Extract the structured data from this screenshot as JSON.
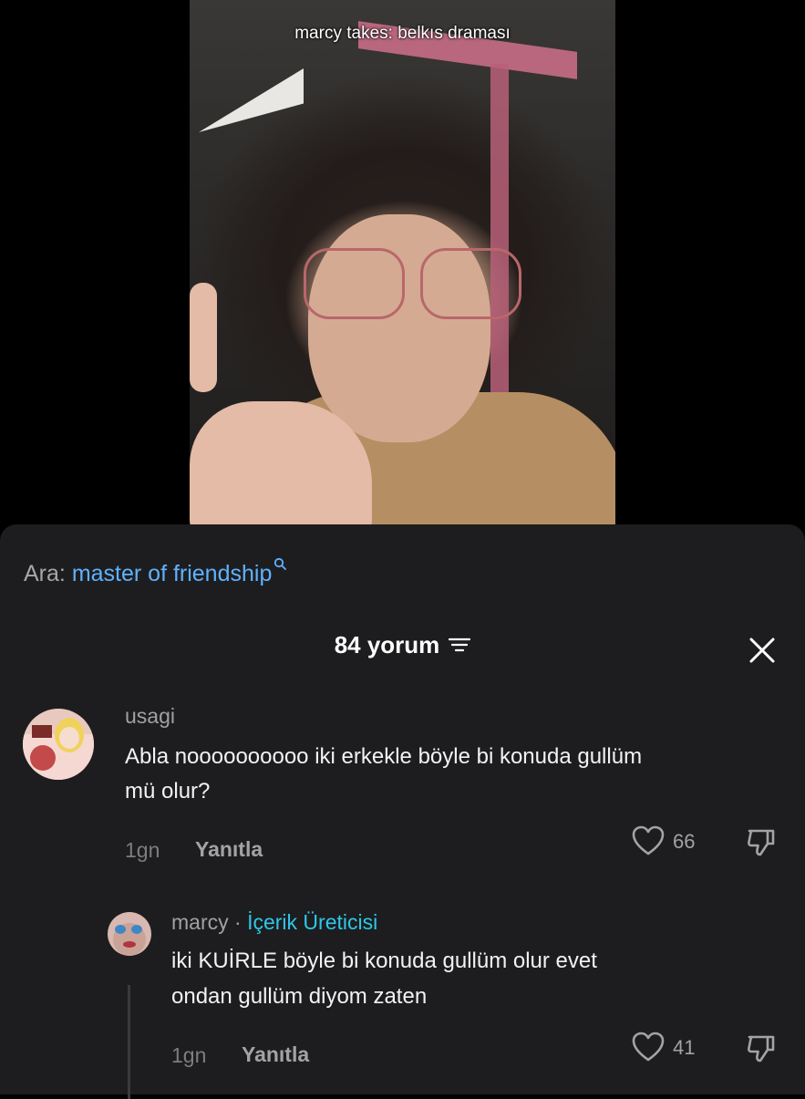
{
  "video": {
    "caption": "marcy takes: belkıs draması"
  },
  "search": {
    "prefix": "Ara:",
    "query": "master of friendship",
    "icon": "search-icon"
  },
  "comments_header": {
    "title": "84 yorum",
    "filter_icon": "filter-icon",
    "close_icon": "close-icon"
  },
  "comments": [
    {
      "username": "usagi",
      "text_line1": "Abla noooooooooo iki erkekle böyle bi konuda gullüm",
      "text_line2": "mü olur?",
      "time": "1gn",
      "reply_label": "Yanıtla",
      "likes": "66"
    },
    {
      "username": "marcy",
      "separator": " · ",
      "badge": "İçerik Üreticisi",
      "text_line1": "iki KUİRLE böyle bi konuda gullüm olur evet",
      "text_line2": "ondan gullüm diyom zaten",
      "time": "1gn",
      "reply_label": "Yanıtla",
      "likes": "41"
    }
  ],
  "colors": {
    "sheet_background": "#1d1d1f",
    "search_link": "#5fb2ff",
    "creator_badge": "#2ec7e8"
  }
}
